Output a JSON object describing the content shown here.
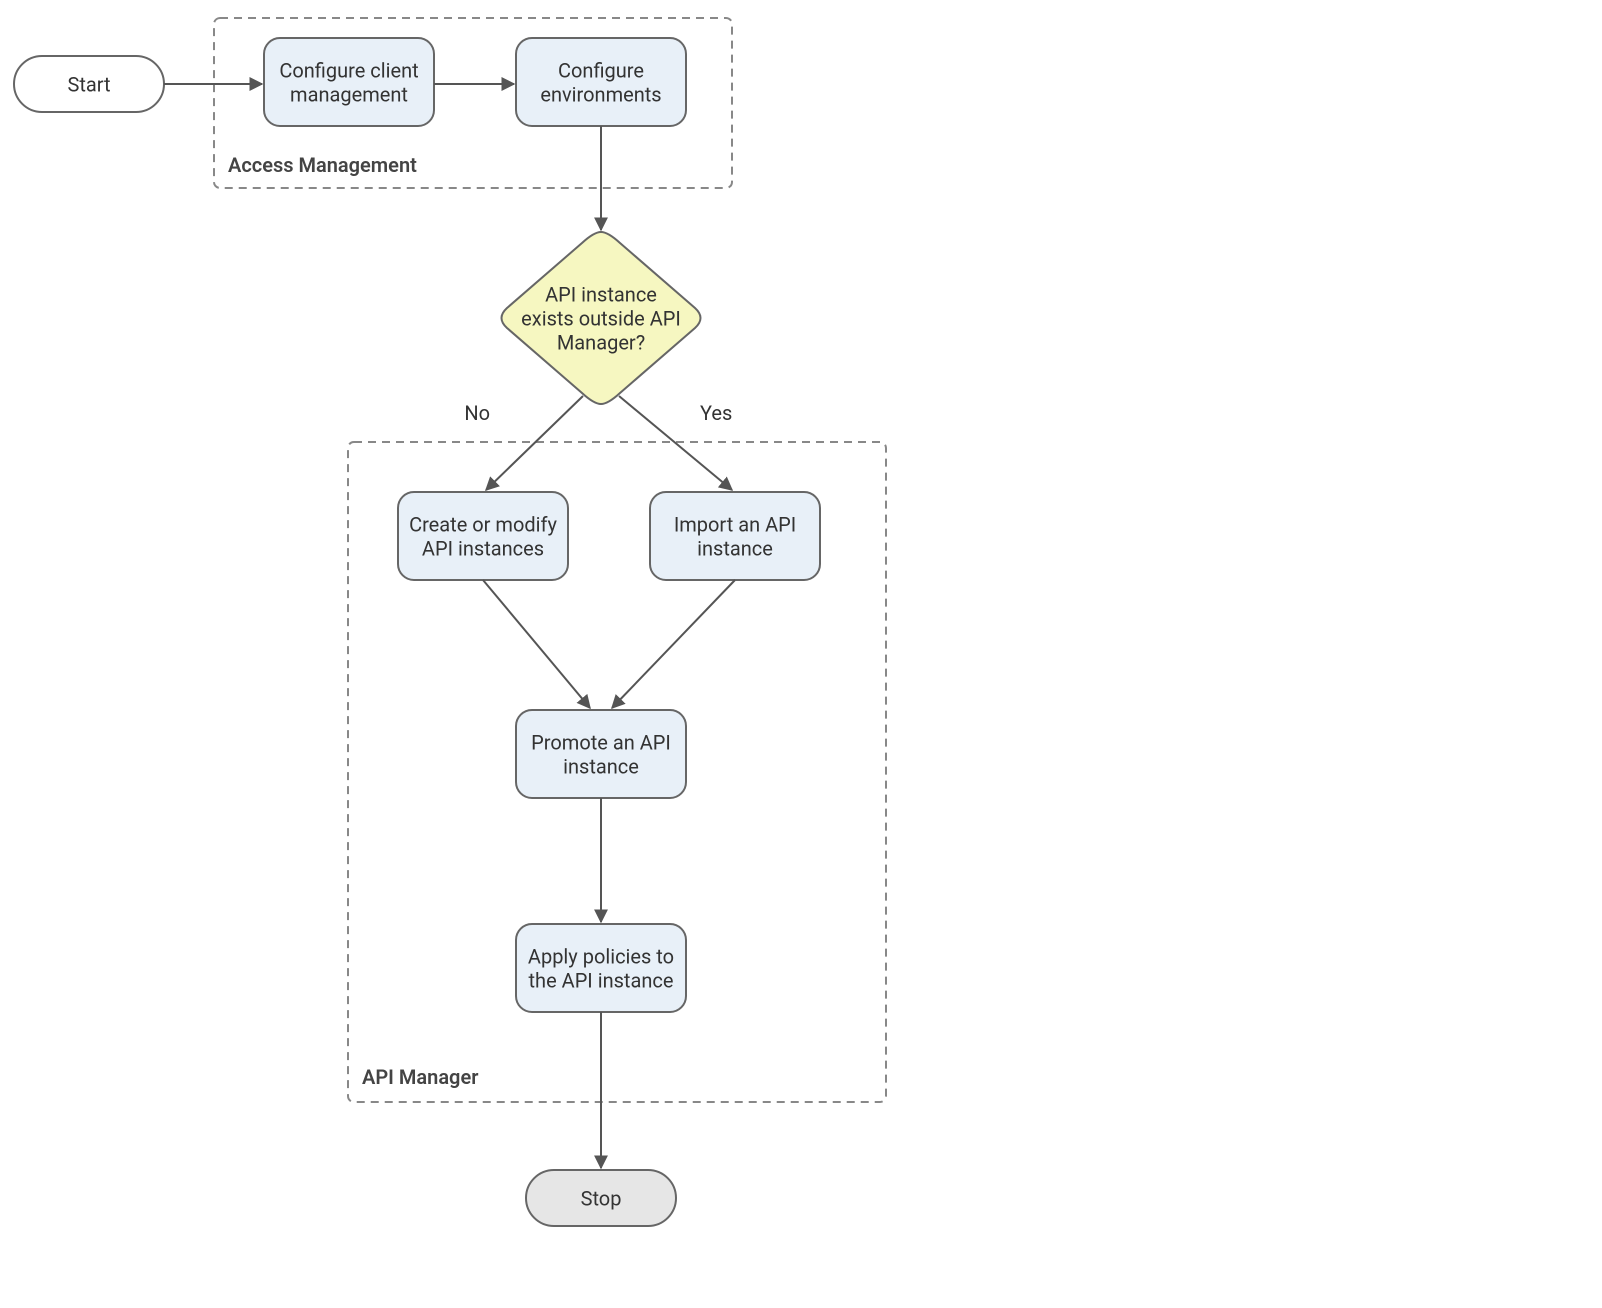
{
  "nodes": {
    "start": "Start",
    "configClient": {
      "l1": "Configure client",
      "l2": "management"
    },
    "configEnv": {
      "l1": "Configure",
      "l2": "environments"
    },
    "decision": {
      "l1": "API instance",
      "l2": "exists outside API",
      "l3": "Manager?"
    },
    "createModify": {
      "l1": "Create or modify",
      "l2": "API instances"
    },
    "importApi": {
      "l1": "Import an API",
      "l2": "instance"
    },
    "promote": {
      "l1": "Promote an API",
      "l2": "instance"
    },
    "applyPolicies": {
      "l1": "Apply policies to",
      "l2": "the API instance"
    },
    "stop": "Stop"
  },
  "groups": {
    "accessMgmt": "Access Management",
    "apiManager": "API Manager"
  },
  "edgeLabels": {
    "no": "No",
    "yes": "Yes"
  }
}
